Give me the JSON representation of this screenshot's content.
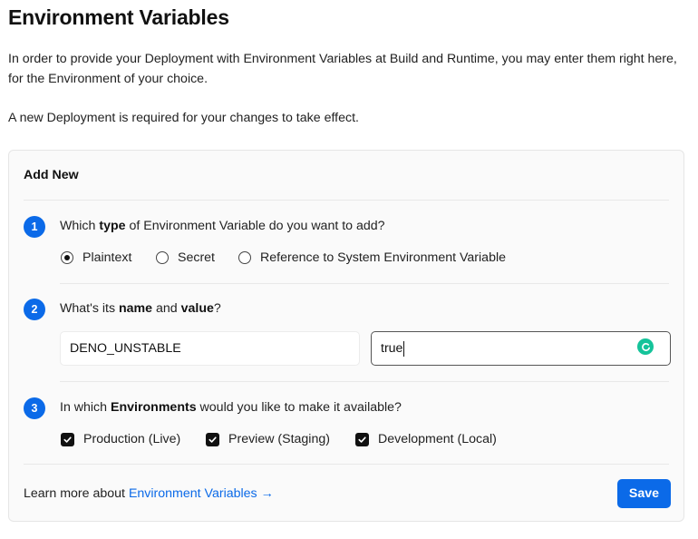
{
  "page": {
    "title": "Environment Variables",
    "intro": "In order to provide your Deployment with Environment Variables at Build and Runtime, you may enter them right here, for the Environment of your choice.",
    "notice": "A new Deployment is required for your changes to take effect."
  },
  "card": {
    "title": "Add New",
    "step1": {
      "number": "1",
      "q_pre": "Which ",
      "q_bold": "type",
      "q_post": " of Environment Variable do you want to add?",
      "options": [
        {
          "label": "Plaintext",
          "selected": true
        },
        {
          "label": "Secret",
          "selected": false
        },
        {
          "label": "Reference to System Environment Variable",
          "selected": false
        }
      ]
    },
    "step2": {
      "number": "2",
      "q_pre": "What's its ",
      "q_bold1": "name",
      "q_mid": " and ",
      "q_bold2": "value",
      "q_post": "?",
      "name_value": "DENO_UNSTABLE",
      "value_value": "true"
    },
    "step3": {
      "number": "3",
      "q_pre": "In which ",
      "q_bold": "Environments",
      "q_post": " would you like to make it available?",
      "options": [
        {
          "label": "Production (Live)",
          "checked": true
        },
        {
          "label": "Preview (Staging)",
          "checked": true
        },
        {
          "label": "Development (Local)",
          "checked": true
        }
      ]
    },
    "footer": {
      "learn_prefix": "Learn more about ",
      "learn_link": "Environment Variables →",
      "save_label": "Save"
    }
  },
  "colors": {
    "accent": "#0b6ae8",
    "grammarly": "#15c39a"
  }
}
